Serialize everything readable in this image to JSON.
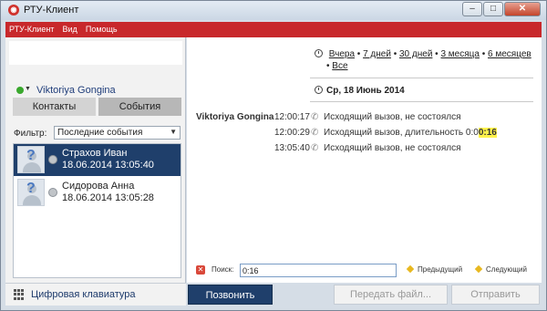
{
  "window": {
    "title": "РТУ-Клиент",
    "app_icon": "app-logo-icon"
  },
  "menu": [
    "РТУ-Клиент",
    "Вид",
    "Помощь"
  ],
  "user": {
    "name": "Viktoriya Gongina",
    "status_color": "#3aa82e"
  },
  "tabs": {
    "contacts": "Контакты",
    "events": "События"
  },
  "filter": {
    "label": "Фильтр:",
    "value": "Последние события"
  },
  "contacts": [
    {
      "name": "Страхов Иван",
      "date": "18.06.2014 13:05:40",
      "selected": true
    },
    {
      "name": "Сидорова Анна",
      "date": "18.06.2014 13:05:28",
      "selected": false
    }
  ],
  "dialpad": {
    "label": "Цифровая клавиатура"
  },
  "history": {
    "periods": [
      "Вчера",
      "7 дней",
      "30 дней",
      "3 месяца",
      "6 месяцев",
      "Все"
    ],
    "date_header": "Ср, 18 Июнь 2014",
    "caller": "Viktoriya Gongina",
    "calls": [
      {
        "time": "12:00:17",
        "text": "Исходящий вызов, не состоялся",
        "duration_prefix": "",
        "duration_highlight": ""
      },
      {
        "time": "12:00:29",
        "text": "Исходящий вызов, длительность 0:0",
        "duration_prefix": "0:0",
        "duration_highlight": "0:16"
      },
      {
        "time": "13:05:40",
        "text": "Исходящий вызов, не состоялся",
        "duration_prefix": "",
        "duration_highlight": ""
      }
    ]
  },
  "search": {
    "label": "Поиск:",
    "value": "0:16",
    "prev": "Предыдущий",
    "next": "Следующий"
  },
  "buttons": {
    "call": "Позвонить",
    "send_file": "Передать файл...",
    "send": "Отправить"
  },
  "colors": {
    "accent_red": "#c8282b",
    "selection_blue": "#1f3f6b",
    "highlight": "#fff34a"
  }
}
